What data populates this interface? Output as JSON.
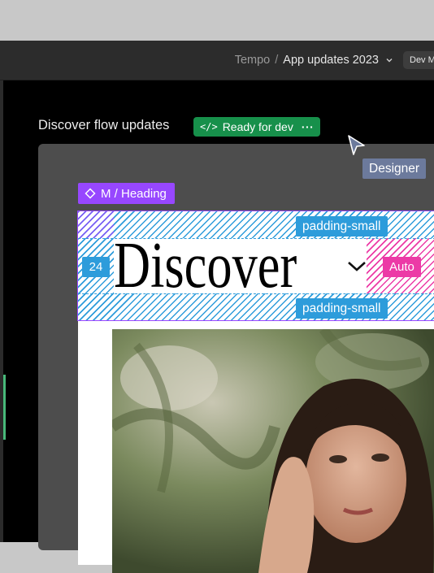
{
  "breadcrumb": {
    "project": "Tempo",
    "separator": "/",
    "file": "App updates 2023"
  },
  "header": {
    "dev_mode_label": "Dev M"
  },
  "frame": {
    "title": "Discover flow updates",
    "status_badge": "Ready for dev",
    "status_color": "#17904b"
  },
  "collaborator": {
    "name": "Designer",
    "color": "#6c7a9c"
  },
  "component": {
    "label": "M / Heading",
    "color": "#9747ff"
  },
  "heading": {
    "text": "Discover"
  },
  "spacing": {
    "top_label": "padding-small",
    "bottom_label": "padding-small",
    "left_value": "24",
    "right_label": "Auto",
    "padding_color": "#2d9cdb",
    "auto_color": "#ec3aa6"
  },
  "icons": {
    "breadcrumb_chevron": "chevron-down-icon",
    "badge_code": "code-icon",
    "badge_more": "more-icon",
    "cursor": "cursor-icon",
    "component": "component-icon",
    "heading_chevron": "chevron-down-icon"
  }
}
